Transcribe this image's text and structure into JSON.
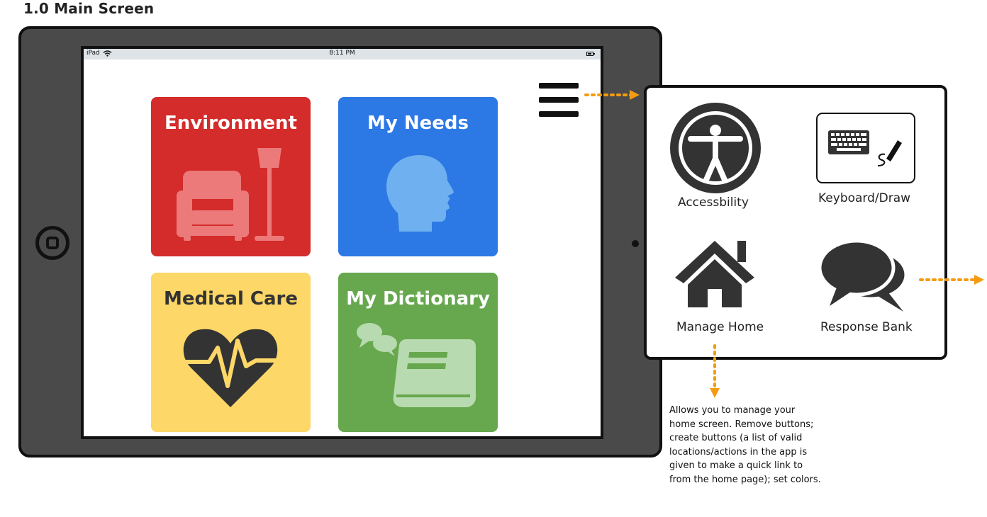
{
  "page": {
    "title": "1.0 Main Screen"
  },
  "status_bar": {
    "device": "iPad",
    "time": "8:11 PM"
  },
  "tiles": [
    {
      "label": "Environment",
      "color": "#d42b2b",
      "icon": "armchair-lamp-icon"
    },
    {
      "label": "My Needs",
      "color": "#2c78e4",
      "icon": "head-profile-icon"
    },
    {
      "label": "Medical Care",
      "color": "#fdd767",
      "icon": "heartbeat-icon"
    },
    {
      "label": "My Dictionary",
      "color": "#67a84e",
      "icon": "book-speech-icon"
    }
  ],
  "menu": {
    "items": [
      {
        "label": "Accessbility",
        "icon": "accessibility-icon"
      },
      {
        "label": "Keyboard/Draw",
        "icon": "keyboard-draw-icon"
      },
      {
        "label": "Manage Home",
        "icon": "house-icon"
      },
      {
        "label": "Response Bank",
        "icon": "speech-bubbles-icon"
      }
    ]
  },
  "annotation": {
    "text": "Allows you to manage your home screen. Remove buttons; create buttons (a list of valid locations/actions in the app is given to make a quick link to from the home page); set colors."
  },
  "colors": {
    "arrow": "#f39c12",
    "tablet": "#4a4a4a",
    "icon_dark": "#333333"
  }
}
